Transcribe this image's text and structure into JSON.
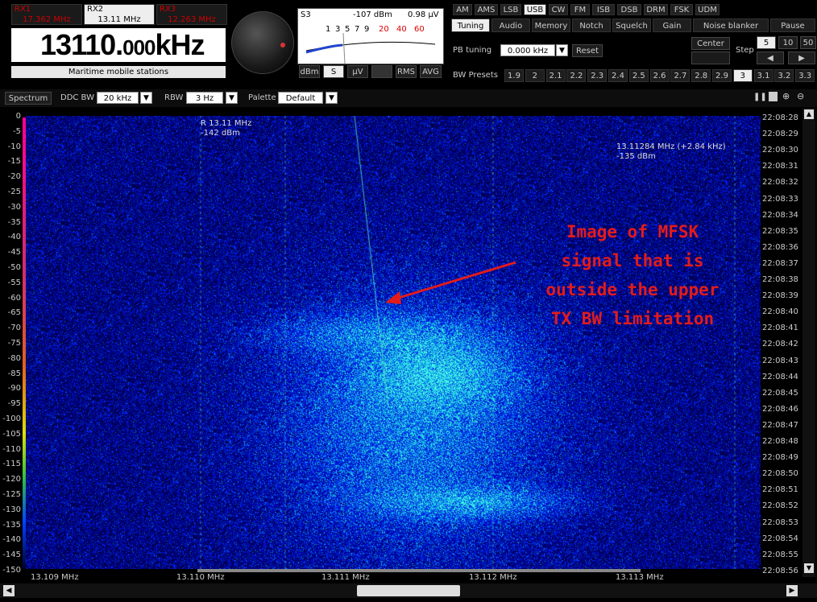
{
  "rx_tabs": [
    {
      "name": "RX1",
      "freq": "17.362 MHz",
      "active": false
    },
    {
      "name": "RX2",
      "freq": "13.11 MHz",
      "active": true
    },
    {
      "name": "RX3",
      "freq": "12.263 MHz",
      "active": false
    }
  ],
  "frequency": {
    "main": "13110.",
    "decimals": "000",
    "unit": "kHz"
  },
  "band_label": "Maritime mobile stations",
  "smeter": {
    "s_value": "S3",
    "dbm": "-107 dBm",
    "uv": "0.98 µV",
    "scale_black": [
      "1",
      "3",
      "5",
      "7",
      "9"
    ],
    "scale_red": [
      "20",
      "40",
      "60"
    ],
    "buttons": [
      "dBm",
      "S",
      "µV",
      "",
      "RMS",
      "AVG"
    ],
    "active_button": "S"
  },
  "modes": [
    "AM",
    "AMS",
    "LSB",
    "USB",
    "CW",
    "FM",
    "ISB",
    "DSB",
    "DRM",
    "FSK",
    "UDM"
  ],
  "active_mode": "USB",
  "tabs": [
    "Tuning",
    "Audio",
    "Memory",
    "Notch",
    "Squelch",
    "Gain",
    "Noise blanker",
    "Pause"
  ],
  "active_tab": "Tuning",
  "tuning": {
    "pb_label": "PB tuning",
    "pb_value": "0.000 kHz",
    "reset": "Reset",
    "center": "Center",
    "step_label": "Step",
    "steps": [
      "5",
      "10",
      "50"
    ],
    "active_step": "5",
    "left_arrow": "◀",
    "right_arrow": "▶"
  },
  "bw_presets_label": "BW Presets",
  "bw_presets": [
    "1.9",
    "2",
    "2.1",
    "2.2",
    "2.3",
    "2.4",
    "2.5",
    "2.6",
    "2.7",
    "2.8",
    "2.9",
    "3",
    "3.1",
    "3.2",
    "3.3"
  ],
  "active_bw": "3",
  "toolbar": {
    "spectrum": "Spectrum",
    "ddc_label": "DDC BW",
    "ddc_value": "20 kHz",
    "rbw_label": "RBW",
    "rbw_value": "3 Hz",
    "palette_label": "Palette",
    "palette_value": "Default"
  },
  "y_axis": [
    "0",
    "-5",
    "-10",
    "-15",
    "-20",
    "-25",
    "-30",
    "-35",
    "-40",
    "-45",
    "-50",
    "-55",
    "-60",
    "-65",
    "-70",
    "-75",
    "-80",
    "-85",
    "-90",
    "-95",
    "-100",
    "-105",
    "-110",
    "-115",
    "-120",
    "-125",
    "-130",
    "-135",
    "-140",
    "-145",
    "-150"
  ],
  "times": [
    "22:08:28",
    "22:08:29",
    "22:08:30",
    "22:08:31",
    "22:08:32",
    "22:08:33",
    "22:08:34",
    "22:08:35",
    "22:08:36",
    "22:08:37",
    "22:08:38",
    "22:08:39",
    "22:08:40",
    "22:08:41",
    "22:08:42",
    "22:08:43",
    "22:08:44",
    "22:08:45",
    "22:08:46",
    "22:08:47",
    "22:08:48",
    "22:08:49",
    "22:08:50",
    "22:08:51",
    "22:08:52",
    "22:08:53",
    "22:08:54",
    "22:08:55",
    "22:08:56"
  ],
  "x_axis": [
    "13.109 MHz",
    "13.110 MHz",
    "13.111 MHz",
    "13.112 MHz",
    "13.113 MHz"
  ],
  "cursor_left": {
    "freq": "R 13.11 MHz",
    "level": "-142 dBm"
  },
  "cursor_right": {
    "freq": "13.11284 MHz (+2.84 kHz)",
    "level": "-135 dBm"
  },
  "annotation": [
    "Image of MFSK",
    "signal that is",
    "outside the upper",
    "TX BW limitation"
  ]
}
